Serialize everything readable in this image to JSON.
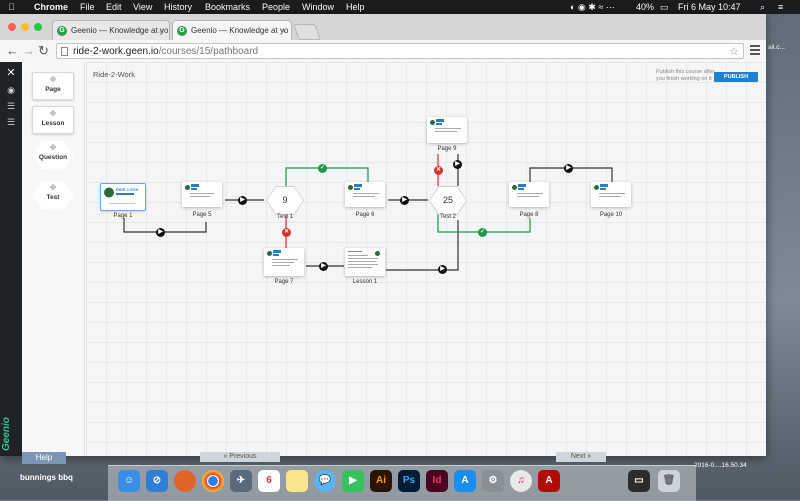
{
  "menubar": {
    "apple": "",
    "app": "Chrome",
    "items": [
      "File",
      "Edit",
      "View",
      "History",
      "Bookmarks",
      "People",
      "Window",
      "Help"
    ],
    "battery": "40%",
    "datetime": "Fri 6 May  10:47"
  },
  "browser": {
    "tabs": [
      {
        "title": "Geenio — Knowledge at yo"
      },
      {
        "title": "Geenio — Knowledge at yo"
      }
    ],
    "url_host": "ride-2-work.geen.io",
    "url_path": "/courses/15/pathboard"
  },
  "palette": {
    "items": [
      {
        "label": "Page"
      },
      {
        "label": "Lesson"
      },
      {
        "label": "Question"
      },
      {
        "label": "Test"
      }
    ]
  },
  "app": {
    "course_title": "Ride-2-Work",
    "publish_hint": "Publish this course after you finish working on it",
    "publish_button": "PUBLISH",
    "brand": "Geenio"
  },
  "nodes": {
    "page1": {
      "label": "Page 1",
      "logo_text": "RIDE 2 SCHOOL"
    },
    "page5": {
      "label": "Page 5"
    },
    "test1": {
      "label": "Test 1",
      "value": "9"
    },
    "page6": {
      "label": "Page 6"
    },
    "test2": {
      "label": "Test 2",
      "value": "25"
    },
    "page9": {
      "label": "Page 9"
    },
    "page8": {
      "label": "Page 8"
    },
    "page10": {
      "label": "Page 10"
    },
    "page7": {
      "label": "Page 7"
    },
    "lesson1": {
      "label": "Lesson 1"
    }
  },
  "badges": {
    "play": "▶",
    "ok": "✓",
    "fail": "✕"
  },
  "colors": {
    "pass": "#1a9a48",
    "fail": "#d9302c",
    "link": "#333333",
    "publish": "#1f7fd0"
  },
  "underlying": {
    "help": "Help",
    "previous": "« Previous",
    "next": "Next »",
    "desktop_label": "bunnings bbq",
    "file_label": "2016-0....16.50.34",
    "bg_file": "ail.c..."
  },
  "dock": [
    {
      "name": "finder-icon"
    },
    {
      "name": "safari-icon"
    },
    {
      "name": "firefox-icon"
    },
    {
      "name": "chrome-icon"
    },
    {
      "name": "migrate-icon"
    },
    {
      "name": "calendar-icon",
      "text": "6"
    },
    {
      "name": "notes-icon"
    },
    {
      "name": "messages-icon"
    },
    {
      "name": "facetime-icon"
    },
    {
      "name": "illustrator-icon",
      "text": "Ai"
    },
    {
      "name": "photoshop-icon",
      "text": "Ps"
    },
    {
      "name": "indesign-icon",
      "text": "Id"
    },
    {
      "name": "appstore-icon"
    },
    {
      "name": "preferences-icon"
    },
    {
      "name": "itunes-icon"
    },
    {
      "name": "acrobat-icon"
    },
    {
      "name": "terminal-icon"
    },
    {
      "name": "trash-icon"
    }
  ]
}
